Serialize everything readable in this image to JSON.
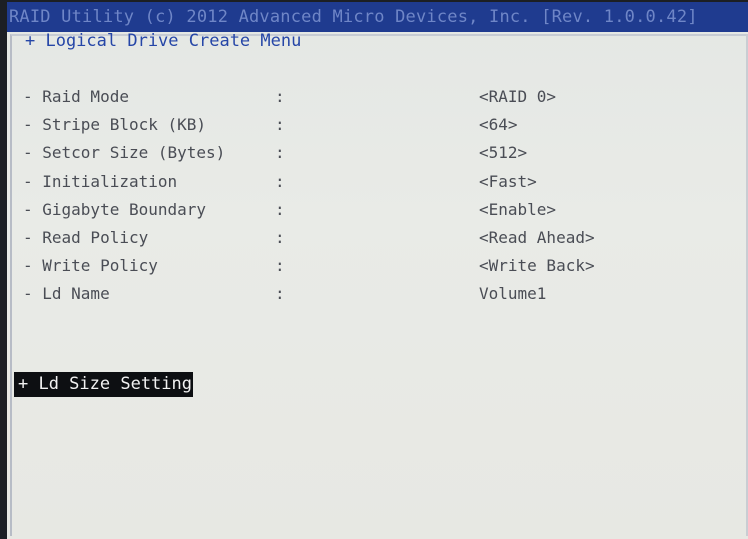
{
  "title_bar": "RAID Utility (c) 2012 Advanced Micro Devices, Inc. [Rev. 1.0.0.42]",
  "menu_title": "+ Logical Drive Create Menu",
  "colon": ":",
  "rows": [
    {
      "label": "- Raid Mode",
      "colon": ":",
      "value": "<RAID 0>"
    },
    {
      "label": "- Stripe Block (KB)",
      "colon": ":",
      "value": "<64>"
    },
    {
      "label": "- Setcor Size (Bytes)",
      "colon": ":",
      "value": "<512>"
    },
    {
      "label": "- Initialization",
      "colon": ":",
      "value": "<Fast>"
    },
    {
      "label": "- Gigabyte Boundary",
      "colon": ":",
      "value": "<Enable>"
    },
    {
      "label": "- Read Policy",
      "colon": ":",
      "value": "<Read Ahead>"
    },
    {
      "label": "- Write Policy",
      "colon": ":",
      "value": "<Write Back>"
    },
    {
      "label": "- Ld Name",
      "colon": ":",
      "value": "Volume1"
    }
  ],
  "ld_size_setting": "+ Ld Size Setting",
  "colors": {
    "title_bar_bg": "#1f3b8f",
    "title_text": "#6f86c7",
    "menu_title": "#2546a7",
    "row_text": "#4a4d55",
    "highlight_bg": "#0d0f12",
    "highlight_text": "#f2f2f2"
  }
}
